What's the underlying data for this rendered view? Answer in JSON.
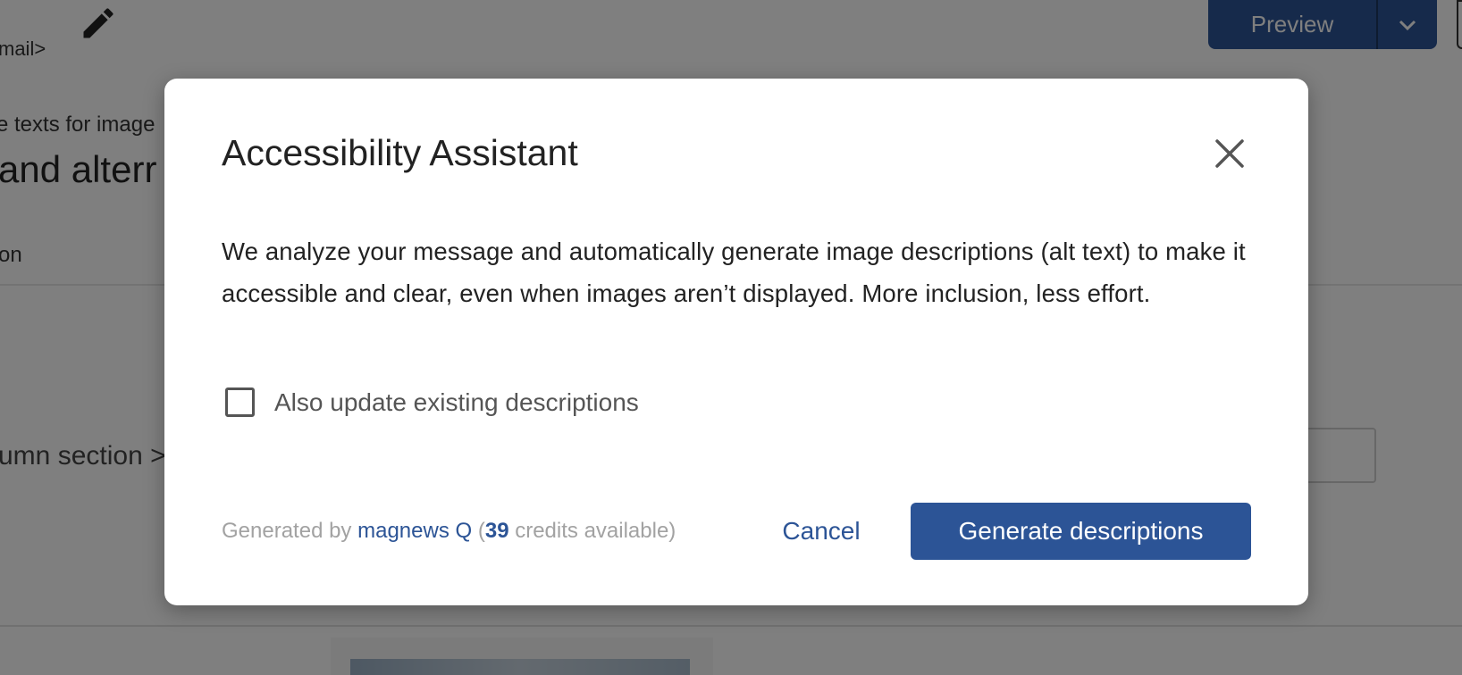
{
  "header": {
    "breadcrumb_fragment": "mail>",
    "edit_icon": "pencil-icon",
    "preview_label": "Preview",
    "dropdown_icon": "chevron-down-icon"
  },
  "page": {
    "subtitle_fragment": "e texts for image",
    "title_fragment": "and alterr",
    "tab_fragment": "on",
    "section_fragment": "umn section >"
  },
  "modal": {
    "title": "Accessibility Assistant",
    "close_icon": "close-icon",
    "description": "We analyze your message and automatically generate image descriptions (alt text) to make it accessible and clear, even when images aren’t displayed. More inclusion, less effort.",
    "checkbox": {
      "label": "Also update existing descriptions",
      "checked": false
    },
    "footer": {
      "generated_prefix": "Generated by ",
      "generated_link": "magnews Q",
      "credits_open": " (",
      "credits_count": "39",
      "credits_suffix": " credits available)",
      "cancel_label": "Cancel",
      "generate_label": "Generate descriptions"
    }
  },
  "colors": {
    "accent": "#2c5496",
    "overlay": "rgba(0,0,0,0.5)",
    "muted_text": "#a2a2a2"
  }
}
